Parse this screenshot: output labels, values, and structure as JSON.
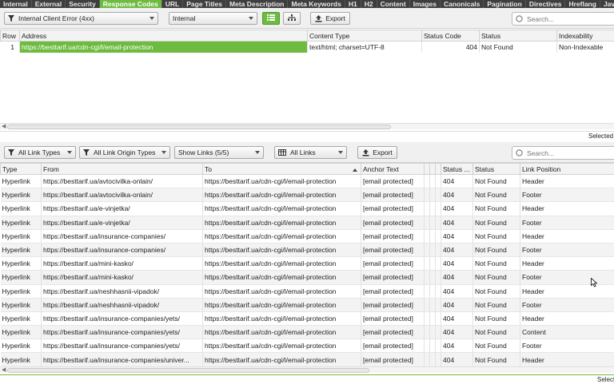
{
  "tabs": [
    "Internal",
    "External",
    "Security",
    "Response Codes",
    "URL",
    "Page Titles",
    "Meta Description",
    "Meta Keywords",
    "H1",
    "H2",
    "Content",
    "Images",
    "Canonicals",
    "Pagination",
    "Directives",
    "Hreflang",
    "JavaScript"
  ],
  "active_tab": 3,
  "top_toolbar": {
    "filter": "Internal Client Error (4xx)",
    "scope": "Internal",
    "export": "Export",
    "search_placeholder": "Search..."
  },
  "top_table": {
    "columns": [
      "Row",
      "Address",
      "Content Type",
      "Status Code",
      "Status",
      "Indexability"
    ],
    "rows": [
      {
        "row": "1",
        "address": "https://besttarif.ua/cdn-cgi/l/email-protection",
        "content_type": "text/html; charset=UTF-8",
        "status_code": "404",
        "status": "Not Found",
        "indexability": "Non-Indexable"
      }
    ],
    "status_text": "Selected"
  },
  "bottom_toolbar": {
    "link_types": "All Link Types",
    "link_origin": "All Link Origin Types",
    "show_links": "Show Links (5/5)",
    "all_links": "All Links",
    "export": "Export",
    "search_placeholder": "Search..."
  },
  "bottom_table": {
    "columns": [
      "Type",
      "From",
      "To",
      "Anchor Text",
      "",
      "",
      "",
      "Status ...",
      "Status",
      "Link Position"
    ],
    "rows": [
      {
        "type": "Hyperlink",
        "from": "https://besttarif.ua/avtocivilka-onlain/",
        "to": "https://besttarif.ua/cdn-cgi/l/email-protection",
        "anchor": "[email protected]",
        "code": "404",
        "status": "Not Found",
        "pos": "Header"
      },
      {
        "type": "Hyperlink",
        "from": "https://besttarif.ua/avtocivilka-onlain/",
        "to": "https://besttarif.ua/cdn-cgi/l/email-protection",
        "anchor": "[email protected]",
        "code": "404",
        "status": "Not Found",
        "pos": "Footer"
      },
      {
        "type": "Hyperlink",
        "from": "https://besttarif.ua/e-vinjetka/",
        "to": "https://besttarif.ua/cdn-cgi/l/email-protection",
        "anchor": "[email protected]",
        "code": "404",
        "status": "Not Found",
        "pos": "Header"
      },
      {
        "type": "Hyperlink",
        "from": "https://besttarif.ua/e-vinjetka/",
        "to": "https://besttarif.ua/cdn-cgi/l/email-protection",
        "anchor": "[email protected]",
        "code": "404",
        "status": "Not Found",
        "pos": "Footer"
      },
      {
        "type": "Hyperlink",
        "from": "https://besttarif.ua/insurance-companies/",
        "to": "https://besttarif.ua/cdn-cgi/l/email-protection",
        "anchor": "[email protected]",
        "code": "404",
        "status": "Not Found",
        "pos": "Header"
      },
      {
        "type": "Hyperlink",
        "from": "https://besttarif.ua/insurance-companies/",
        "to": "https://besttarif.ua/cdn-cgi/l/email-protection",
        "anchor": "[email protected]",
        "code": "404",
        "status": "Not Found",
        "pos": "Footer"
      },
      {
        "type": "Hyperlink",
        "from": "https://besttarif.ua/mini-kasko/",
        "to": "https://besttarif.ua/cdn-cgi/l/email-protection",
        "anchor": "[email protected]",
        "code": "404",
        "status": "Not Found",
        "pos": "Header"
      },
      {
        "type": "Hyperlink",
        "from": "https://besttarif.ua/mini-kasko/",
        "to": "https://besttarif.ua/cdn-cgi/l/email-protection",
        "anchor": "[email protected]",
        "code": "404",
        "status": "Not Found",
        "pos": "Footer"
      },
      {
        "type": "Hyperlink",
        "from": "https://besttarif.ua/neshhasnii-vipadok/",
        "to": "https://besttarif.ua/cdn-cgi/l/email-protection",
        "anchor": "[email protected]",
        "code": "404",
        "status": "Not Found",
        "pos": "Header"
      },
      {
        "type": "Hyperlink",
        "from": "https://besttarif.ua/neshhasnii-vipadok/",
        "to": "https://besttarif.ua/cdn-cgi/l/email-protection",
        "anchor": "[email protected]",
        "code": "404",
        "status": "Not Found",
        "pos": "Footer"
      },
      {
        "type": "Hyperlink",
        "from": "https://besttarif.ua/insurance-companies/yets/",
        "to": "https://besttarif.ua/cdn-cgi/l/email-protection",
        "anchor": "[email protected]",
        "code": "404",
        "status": "Not Found",
        "pos": "Header"
      },
      {
        "type": "Hyperlink",
        "from": "https://besttarif.ua/insurance-companies/yets/",
        "to": "https://besttarif.ua/cdn-cgi/l/email-protection",
        "anchor": "[email protected]",
        "code": "404",
        "status": "Not Found",
        "pos": "Content"
      },
      {
        "type": "Hyperlink",
        "from": "https://besttarif.ua/insurance-companies/yets/",
        "to": "https://besttarif.ua/cdn-cgi/l/email-protection",
        "anchor": "[email protected]",
        "code": "404",
        "status": "Not Found",
        "pos": "Footer"
      },
      {
        "type": "Hyperlink",
        "from": "https://besttarif.ua/insurance-companies/univer...",
        "to": "https://besttarif.ua/cdn-cgi/l/email-protection",
        "anchor": "[email protected]",
        "code": "404",
        "status": "Not Found",
        "pos": "Header"
      }
    ],
    "status_text": "Selected"
  },
  "colors": {
    "accent": "#6dbb3f",
    "tabbar": "#3e3e3e"
  }
}
